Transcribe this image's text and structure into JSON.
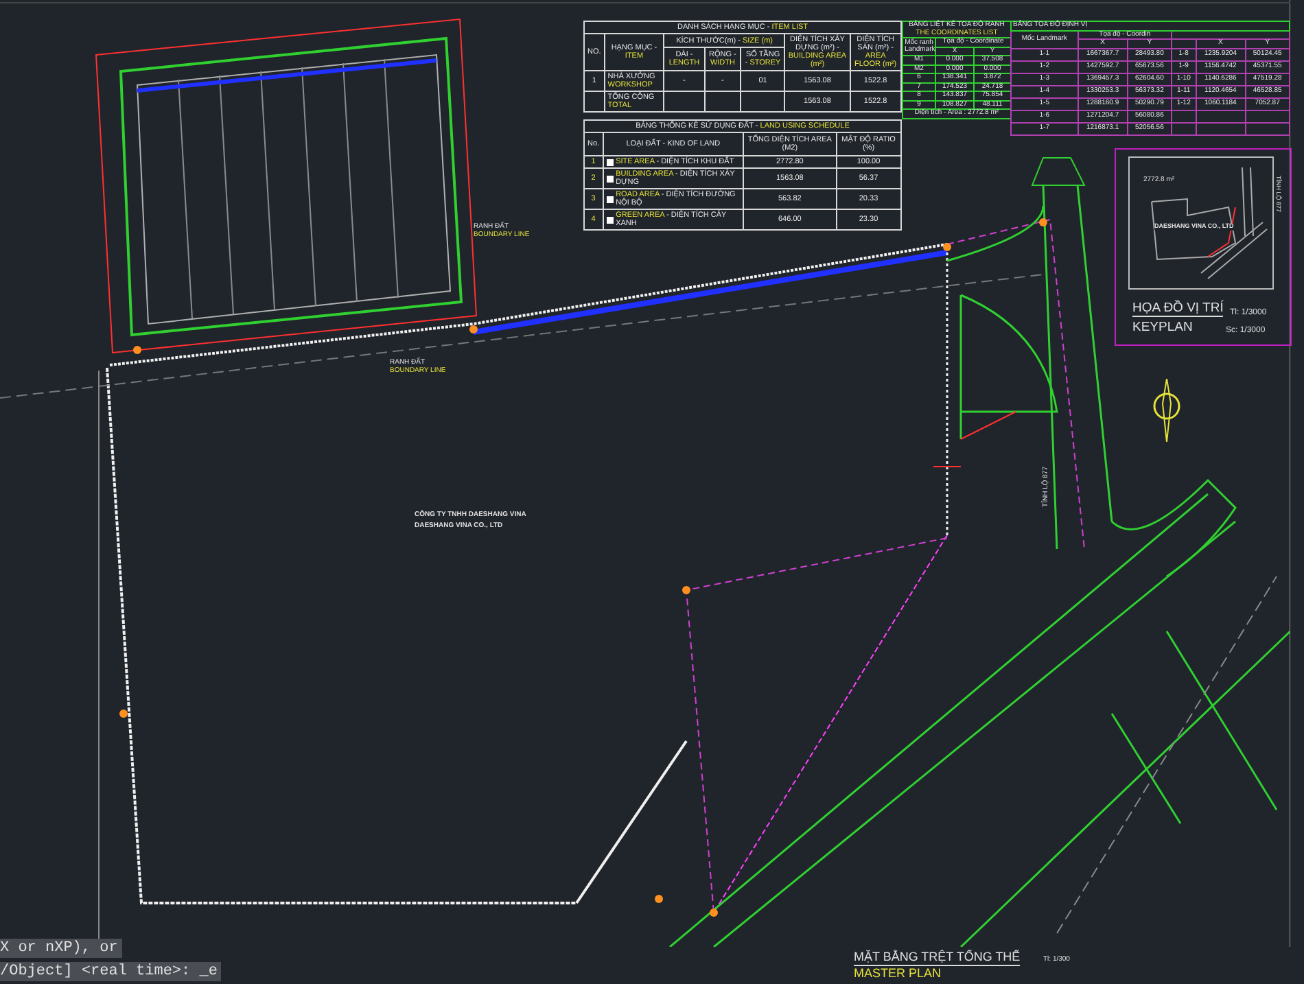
{
  "item_list": {
    "title": {
      "vi": "DANH SÁCH HẠNG MỤC -",
      "en": "ITEM LIST"
    },
    "headers": [
      {
        "vi": "NO."
      },
      {
        "vi": "HẠNG MỤC -",
        "en": "ITEM"
      },
      {
        "vi": "KÍCH THƯỚC(m) -",
        "en": "SIZE (m)"
      },
      {
        "vi": "DIỆN TÍCH XÂY DỰNG (m²) -",
        "en": "BUILDING AREA (m²)"
      },
      {
        "vi": "DIỆN TÍCH SÀN (m²) -",
        "en": "AREA FLOOR (m²)"
      }
    ],
    "subheaders": [
      {
        "vi": "DÀI -",
        "en": "LENGTH"
      },
      {
        "vi": "RỘNG -",
        "en": "WIDTH"
      },
      {
        "vi": "SỐ TẦNG -",
        "en": "STOREY"
      }
    ],
    "rows": [
      [
        "1",
        {
          "vi": "NHÀ XƯỞNG",
          "en": "WORKSHOP"
        },
        "-",
        "-",
        "01",
        "1563.08",
        "1522.8"
      ],
      [
        "",
        {
          "vi": "TỔNG CỘNG",
          "en": "TOTAL"
        },
        "",
        "",
        "",
        "1563.08",
        "1522.8"
      ]
    ]
  },
  "land_use": {
    "title": {
      "vi": "BẢNG THỐNG KÊ SỬ DỤNG ĐẤT -",
      "en": "LAND USING SCHEDULE"
    },
    "headers": [
      "No.",
      {
        "vi": "LOẠI ĐẤT - KIND OF LAND"
      },
      "TỔNG DIỆN TÍCH AREA (M2)",
      "MẬT ĐỘ RATIO (%)"
    ],
    "rows": [
      {
        "no": "1",
        "en": "SITE AREA",
        "vi": "- DIỆN TÍCH KHU ĐẤT",
        "area": "2772.80",
        "ratio": "100.00"
      },
      {
        "no": "2",
        "en": "BUILDING AREA",
        "vi": "- DIỆN TÍCH XÂY DỰNG",
        "area": "1563.08",
        "ratio": "56.37"
      },
      {
        "no": "3",
        "en": "ROAD AREA",
        "vi": "- DIỆN TÍCH ĐƯỜNG NỘI BỘ",
        "area": "563.82",
        "ratio": "20.33"
      },
      {
        "no": "4",
        "en": "GREEN AREA",
        "vi": "- DIỆN TÍCH CÂY XANH",
        "area": "646.00",
        "ratio": "23.30"
      }
    ]
  },
  "coordinates_list": {
    "title": "BẢNG LIỆT KÊ TỌA ĐỘ RANH",
    "subtitle": "THE COORDINATES LIST",
    "headers": [
      "Mốc ranh Landmark",
      "Tọa độ - Coordinate",
      "X",
      "Y"
    ],
    "rows": [
      [
        "M1",
        "0.000",
        "37.508"
      ],
      [
        "M2",
        "0.000",
        "0.000"
      ],
      [
        "6",
        "138.341",
        "3.872"
      ],
      [
        "7",
        "174.523",
        "24.718"
      ],
      [
        "8",
        "143.837",
        "75.854"
      ],
      [
        "9",
        "108.827",
        "48.111"
      ]
    ],
    "area": "Diện tích - Area :   2772.8 m²"
  },
  "location_table": {
    "title": "BẢNG TỌA ĐỘ ĐỊNH VỊ",
    "headers": [
      "Mốc Landmark",
      "Tọa độ - Coordin",
      "X",
      "Y",
      "X",
      "Y"
    ],
    "rows": [
      [
        "1-1",
        "1667367.7",
        "28493.80",
        "1-8",
        "1235.9204",
        "50124.45"
      ],
      [
        "1-2",
        "1427592.7",
        "65673.56",
        "1-9",
        "1156.4742",
        "45371.55"
      ],
      [
        "1-3",
        "1369457.3",
        "62604.60",
        "1-10",
        "1140.6286",
        "47519.28"
      ],
      [
        "1-4",
        "1330253.3",
        "56373.32",
        "1-11",
        "1120.4654",
        "46528.85"
      ],
      [
        "1-5",
        "1288160.9",
        "50290.79",
        "1-12",
        "1060.1184",
        "7052.87"
      ],
      [
        "1-6",
        "1271204.7",
        "56080.86",
        "",
        "",
        " "
      ],
      [
        "1-7",
        "1216873.1",
        "52056.56",
        "",
        "",
        ""
      ]
    ]
  },
  "keyplan": {
    "title": "HỌA ĐỒ VỊ TRÍ",
    "scale_vi": "Tl: 1/3000",
    "title_en": "KEYPLAN",
    "scale_en": "Sc: 1/3000",
    "lot_area": "2772.8 m²",
    "company": "DAESHANG VINA CO., LTD",
    "road": "TỈNH LỘ 877"
  },
  "site": {
    "company_vi": "CÔNG TY TNHH DAESHANG VINA",
    "company_en": "DAESHANG VINA CO., LTD",
    "boundary_labels": [
      {
        "vi": "RANH ĐẤT",
        "en": "BOUNDARY LINE"
      },
      {
        "vi": "RANH ĐẤT",
        "en": "BOUNDARY LINE"
      }
    ],
    "road_label": "TỈNH LỘ 877"
  },
  "drawing_title": {
    "vi": "MẶT BẰNG TRỆT TỔNG THỂ",
    "scale": "Tl: 1/300",
    "en": "MASTER PLAN"
  },
  "command_line": [
    "X or nXP), or",
    "/Object] <real time>: _e"
  ]
}
